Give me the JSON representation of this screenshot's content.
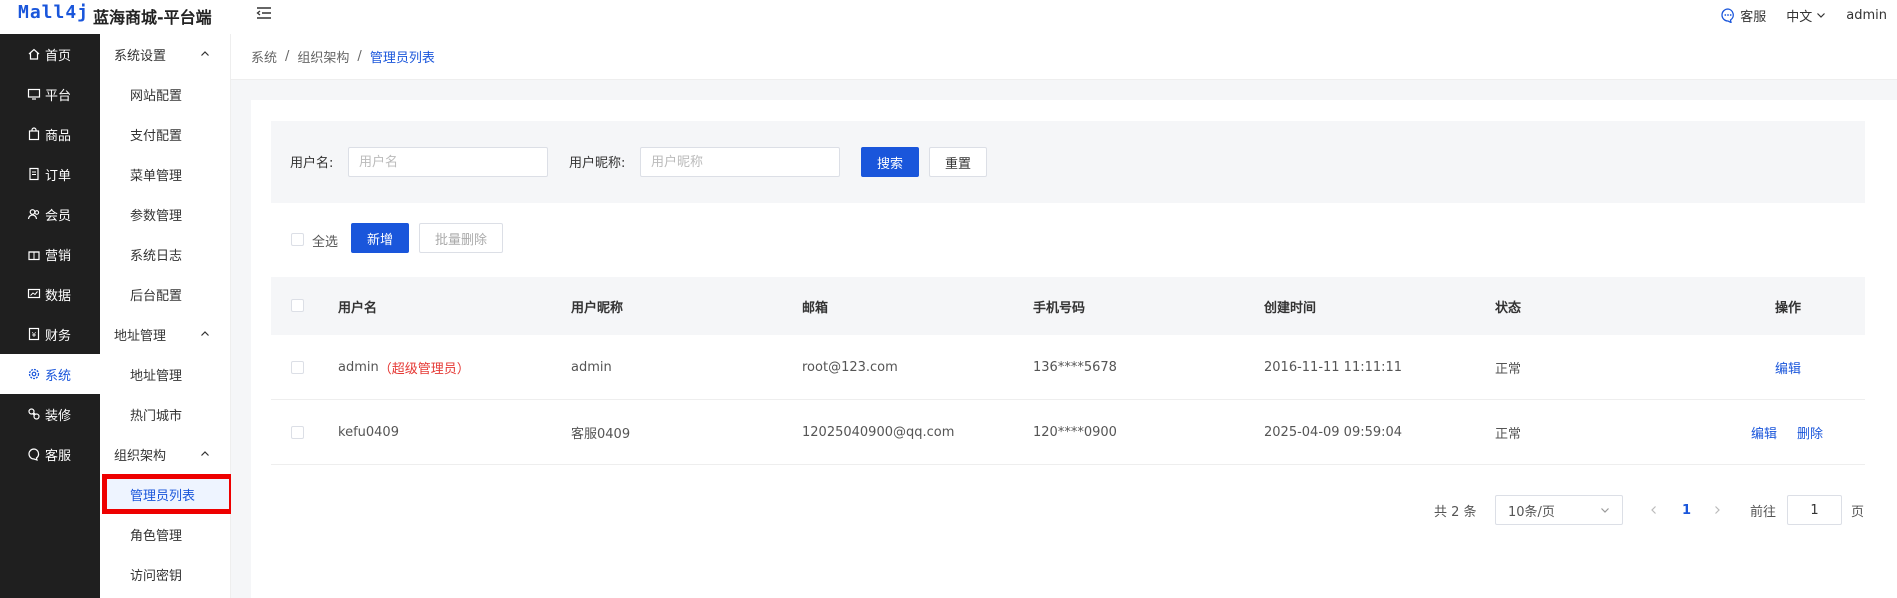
{
  "header": {
    "logo": "Mall4j",
    "title": "蓝海商城-平台端",
    "service": "客服",
    "language": "中文",
    "user": "admin"
  },
  "primary_nav": [
    {
      "label": "首页",
      "icon": "home-icon"
    },
    {
      "label": "平台",
      "icon": "monitor-icon"
    },
    {
      "label": "商品",
      "icon": "bag-icon"
    },
    {
      "label": "订单",
      "icon": "document-icon"
    },
    {
      "label": "会员",
      "icon": "users-icon"
    },
    {
      "label": "营销",
      "icon": "gift-icon"
    },
    {
      "label": "数据",
      "icon": "chart-icon"
    },
    {
      "label": "财务",
      "icon": "finance-icon"
    },
    {
      "label": "系统",
      "icon": "settings-icon",
      "active": true
    },
    {
      "label": "装修",
      "icon": "brush-icon"
    },
    {
      "label": "客服",
      "icon": "chat-icon"
    }
  ],
  "secondary_nav": {
    "group1": "系统设置",
    "group1_items": [
      "网站配置",
      "支付配置",
      "菜单管理",
      "参数管理",
      "系统日志",
      "后台配置"
    ],
    "group2": "地址管理",
    "group2_items": [
      "地址管理",
      "热门城市"
    ],
    "group3": "组织架构",
    "group3_items": [
      "管理员列表",
      "角色管理",
      "访问密钥"
    ]
  },
  "breadcrumb": [
    "系统",
    "组织架构",
    "管理员列表"
  ],
  "search": {
    "username_label": "用户名:",
    "username_placeholder": "用户名",
    "nickname_label": "用户昵称:",
    "nickname_placeholder": "用户昵称",
    "search_btn": "搜索",
    "reset_btn": "重置"
  },
  "toolbar": {
    "select_all": "全选",
    "add": "新增",
    "batch_delete": "批量删除"
  },
  "table": {
    "headers": [
      "用户名",
      "用户昵称",
      "邮箱",
      "手机号码",
      "创建时间",
      "状态",
      "操作"
    ],
    "rows": [
      {
        "username": "admin",
        "tag": "（超级管理员）",
        "nickname": "admin",
        "email": "root@123.com",
        "phone": "136****5678",
        "created": "2016-11-11 11:11:11",
        "status": "正常",
        "actions": [
          "编辑"
        ]
      },
      {
        "username": "kefu0409",
        "tag": "",
        "nickname": "客服0409",
        "email": "12025040900@qq.com",
        "phone": "120****0900",
        "created": "2025-04-09 09:59:04",
        "status": "正常",
        "actions": [
          "编辑",
          "删除"
        ]
      }
    ]
  },
  "pagination": {
    "total": "共 2 条",
    "page_size": "10条/页",
    "current": "1",
    "goto_label": "前往",
    "goto_value": "1",
    "page_suffix": "页"
  },
  "colors": {
    "primary": "#1a56db",
    "sidebar_bg": "#1f1f1f",
    "highlight_red": "#e00000"
  }
}
